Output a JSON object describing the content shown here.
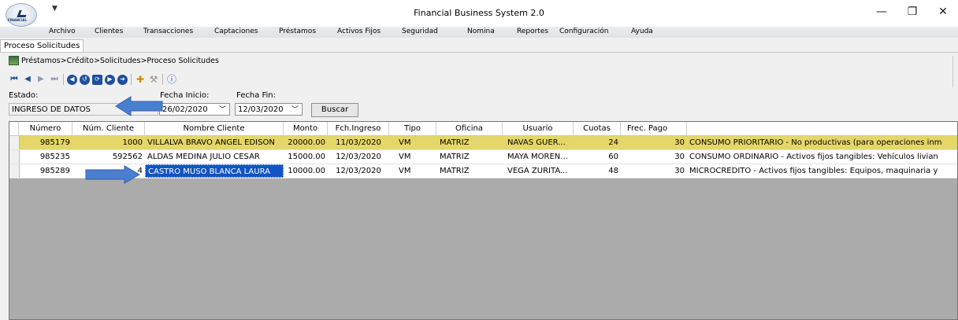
{
  "window": {
    "title": "Financial Business System 2.0",
    "logo_text": "FINANCIAL",
    "controls": {
      "minimize": "—",
      "maximize": "❐",
      "close": "✕"
    }
  },
  "menu": [
    "Archivo",
    "Clientes",
    "Transacciones",
    "Captaciones",
    "Préstamos",
    "Activos Fijos",
    "Seguridad",
    "Nomina",
    "Reportes",
    "Configuración",
    "Ayuda"
  ],
  "tab": {
    "label": "Proceso Solicitudes"
  },
  "breadcrumb": "Préstamos>Crédito>Solicitudes>Proceso Solicitudes",
  "filters": {
    "estado_label": "Estado:",
    "estado_value": "INGRESO DE DATOS",
    "fecha_inicio_label": "Fecha Inicio:",
    "fecha_inicio_value": "26/02/2020",
    "fecha_fin_label": "Fecha Fin:",
    "fecha_fin_value": "12/03/2020",
    "buscar_label": "Buscar"
  },
  "grid": {
    "headers": [
      "Número",
      "Núm. Cliente",
      "Nombre Cliente",
      "Monto",
      "Fch.Ingreso",
      "Tipo",
      "Oficina",
      "Usuario",
      "Cuotas",
      "Frec. Pago",
      ""
    ],
    "rows": [
      {
        "numero": "985179",
        "num_cliente": "1000",
        "nombre": "VILLALVA BRAVO ANGEL EDISON",
        "monto": "20000.00",
        "fecha": "11/03/2020",
        "tipo": "VM",
        "oficina": "MATRIZ",
        "usuario": "NAVAS GUER...",
        "cuotas": "24",
        "frec": "30",
        "destino": "CONSUMO PRIORITARIO - No productivas (para operaciones inm"
      },
      {
        "numero": "985235",
        "num_cliente": "592562",
        "nombre": "ALDAS MEDINA JULIO CESAR",
        "monto": "15000.00",
        "fecha": "12/03/2020",
        "tipo": "VM",
        "oficina": "MATRIZ",
        "usuario": "MAYA MOREN...",
        "cuotas": "60",
        "frec": "30",
        "destino": "CONSUMO ORDINARIO - Activos fijos tangibles: Vehículos livian"
      },
      {
        "numero": "985289",
        "num_cliente": "4",
        "nombre": "CASTRO MUSO BLANCA LAURA",
        "monto": "10000.00",
        "fecha": "12/03/2020",
        "tipo": "VM",
        "oficina": "MATRIZ",
        "usuario": "VEGA ZURITA...",
        "cuotas": "48",
        "frec": "30",
        "destino": "MICROCREDITO - Activos fijos tangibles: Equipos, maquinaria y"
      }
    ]
  },
  "colors": {
    "selected_row": "#e4d768",
    "highlight_cell": "#1254c4",
    "arrow": "#4a7fd0"
  }
}
